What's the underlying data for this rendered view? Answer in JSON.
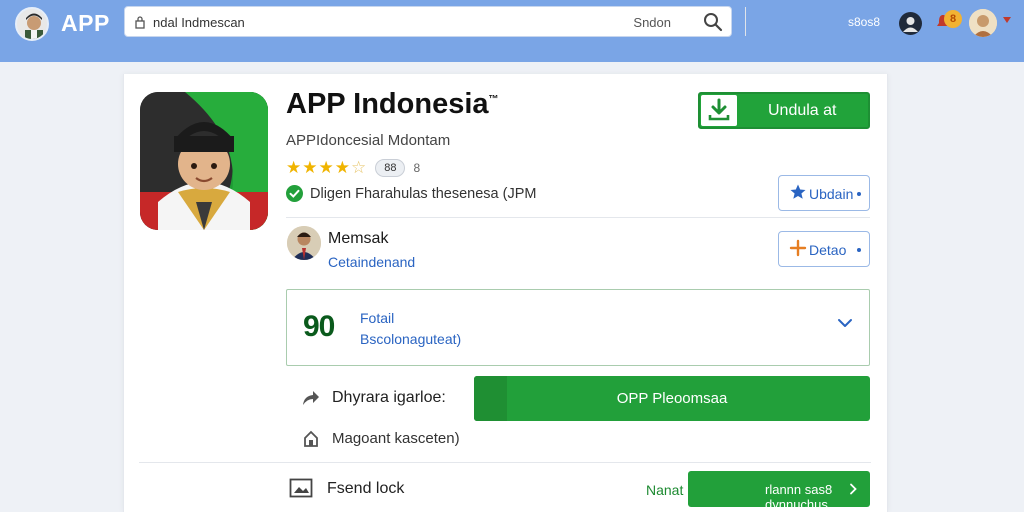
{
  "header": {
    "app_name": "APP",
    "search_query": "ndal Indmescan",
    "search_button": "Sndon",
    "right_text": "s8os8",
    "notification_count": "8"
  },
  "app": {
    "title": "APP Indonesia",
    "trademark": "™",
    "subtitle": "APPIdoncesial Mdontam",
    "rating_value": "88",
    "rating_count": "8",
    "verified_text": "Dligen Fharahulas thesenesa (JPM",
    "download_label": "Undula at",
    "actions": [
      {
        "icon": "star-icon",
        "label": "Ubdain"
      },
      {
        "icon": "plus-icon",
        "label": "Detao"
      }
    ]
  },
  "developer": {
    "name": "Memsak",
    "handle": "Cetaindenand"
  },
  "detail": {
    "badge": "90",
    "line1": "Fotail",
    "line2": "Bscolonaguteat)"
  },
  "share": {
    "label": "Dhyrara igarloe:",
    "button_label": "OPP Pleoomsaa"
  },
  "home": {
    "label": "Magoant kasceten)"
  },
  "footer": {
    "label": "Fsend lock",
    "note": "Nanat",
    "button_label": "rlannn sas8 dynnuchus"
  },
  "colors": {
    "topbar": "#7aa5e6",
    "accent_green": "#22a03a",
    "link_blue": "#2a64c2",
    "star_gold": "#f0b400"
  }
}
